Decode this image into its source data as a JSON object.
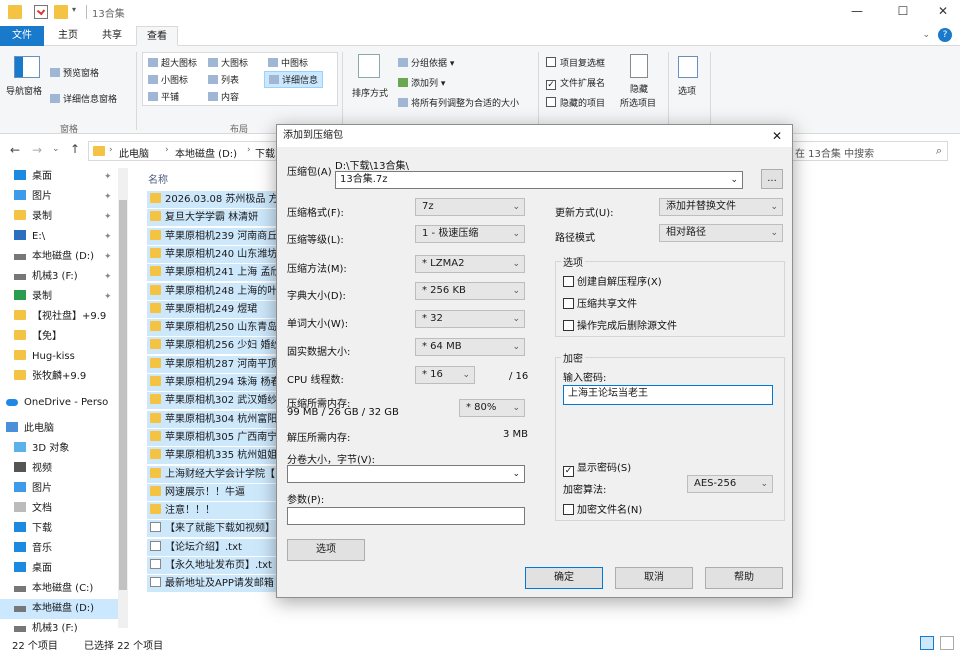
{
  "window": {
    "title": "13合集",
    "controls": {
      "minimize": "—",
      "maximize": "☐",
      "close": "✕"
    }
  },
  "ribbon_tabs": [
    "文件",
    "主页",
    "共享",
    "查看"
  ],
  "ribbon": {
    "pane_group": {
      "nav_pane": "导航窗格",
      "preview_pane": "预览窗格",
      "details_pane": "详细信息窗格",
      "label": "窗格"
    },
    "layout_group": {
      "items": [
        "超大图标",
        "大图标",
        "中图标",
        "小图标",
        "列表",
        "详细信息",
        "平铺",
        "内容"
      ],
      "label": "布局"
    },
    "current_view_group": {
      "sort": "排序方式",
      "group_by": "分组依据",
      "add_column": "添加列",
      "fit_columns": "将所有列调整为合适的大小"
    },
    "show_hide_group": {
      "item_checkbox": "项目复选框",
      "file_ext": "文件扩展名",
      "hidden_items": "隐藏的项目",
      "hide_selected_1": "隐藏",
      "hide_selected_2": "所选项目"
    },
    "options": "选项"
  },
  "address": {
    "path": [
      "此电脑",
      "本地磁盘 (D:)",
      "下载"
    ],
    "search_placeholder": "在 13合集 中搜索"
  },
  "nav": [
    {
      "label": "桌面",
      "pinned": true
    },
    {
      "label": "图片",
      "pinned": true
    },
    {
      "label": "录制",
      "pinned": true
    },
    {
      "label": "E:\\",
      "pinned": true
    },
    {
      "label": "本地磁盘 (D:)",
      "pinned": true
    },
    {
      "label": "机械3 (F:)",
      "pinned": true
    },
    {
      "label": "录制",
      "pinned": true
    },
    {
      "label": "【视社盘】+9.9",
      "pinned": false
    },
    {
      "label": "【免】",
      "pinned": false
    },
    {
      "label": "Hug-kiss",
      "pinned": false
    },
    {
      "label": "张牧麟+9.9",
      "pinned": false
    },
    {
      "label": "OneDrive - Perso",
      "pinned": false
    },
    {
      "label": "此电脑",
      "pinned": false
    },
    {
      "label": "3D 对象",
      "pinned": false
    },
    {
      "label": "视频",
      "pinned": false
    },
    {
      "label": "图片",
      "pinned": false
    },
    {
      "label": "文档",
      "pinned": false
    },
    {
      "label": "下载",
      "pinned": false
    },
    {
      "label": "音乐",
      "pinned": false
    },
    {
      "label": "桌面",
      "pinned": false
    },
    {
      "label": "本地磁盘 (C:)",
      "pinned": false
    },
    {
      "label": "本地磁盘 (D:)",
      "pinned": false
    },
    {
      "label": "机械3 (F:)",
      "pinned": false
    }
  ],
  "filelist": {
    "header": "名称",
    "rows": [
      {
        "name": "2026.03.08 苏州极品 方",
        "type": "folder"
      },
      {
        "name": "复旦大学学霸 林清妍",
        "type": "folder"
      },
      {
        "name": "苹果原相机239 河南商丘",
        "type": "folder"
      },
      {
        "name": "苹果原相机240 山东潍坊",
        "type": "folder"
      },
      {
        "name": "苹果原相机241 上海 孟欣",
        "type": "folder"
      },
      {
        "name": "苹果原相机248 上海的叶",
        "type": "folder"
      },
      {
        "name": "苹果原相机249 煜珺",
        "type": "folder"
      },
      {
        "name": "苹果原相机250 山东青岛",
        "type": "folder"
      },
      {
        "name": "苹果原相机256 少妇 婚纱",
        "type": "folder"
      },
      {
        "name": "苹果原相机287 河南平顶",
        "type": "folder"
      },
      {
        "name": "苹果原相机294 珠海 杨春",
        "type": "folder"
      },
      {
        "name": "苹果原相机302 武汉婚纱",
        "type": "folder"
      },
      {
        "name": "苹果原相机304 杭州富阳",
        "type": "folder"
      },
      {
        "name": "苹果原相机305 广西南宁",
        "type": "folder"
      },
      {
        "name": "苹果原相机335 杭州姐姐",
        "type": "folder"
      },
      {
        "name": "上海财经大学会计学院【",
        "type": "folder"
      },
      {
        "name": "网速展示！！牛逼",
        "type": "folder"
      },
      {
        "name": "注意！！！",
        "type": "folder"
      },
      {
        "name": "【来了就能下载如视频】.",
        "type": "txt"
      },
      {
        "name": "【论坛介绍】.txt",
        "type": "txt"
      },
      {
        "name": "【永久地址发布页】.txt",
        "type": "txt"
      },
      {
        "name": "最新地址及APP请发邮箱",
        "type": "txt"
      }
    ]
  },
  "status": {
    "count": "22 个项目",
    "selected": "已选择 22 个项目"
  },
  "dialog": {
    "title": "添加到压缩包",
    "archive_label": "压缩包(A)",
    "archive_dir": "D:\\下载\\13合集\\",
    "archive_name": "13合集.7z",
    "browse": "...",
    "format_label": "压缩格式(F):",
    "format_value": "7z",
    "level_label": "压缩等级(L):",
    "level_value": "1 - 极速压缩",
    "method_label": "压缩方法(M):",
    "method_value": "* LZMA2",
    "dict_label": "字典大小(D):",
    "dict_value": "* 256 KB",
    "word_label": "单词大小(W):",
    "word_value": "* 32",
    "solid_label": "固实数据大小:",
    "solid_value": "* 64 MB",
    "cpu_label": "CPU 线程数:",
    "cpu_value": "* 16",
    "cpu_total": "/ 16",
    "mem_label": "压缩所需内存:",
    "mem_detail": "99 MB / 26 GB / 32 GB",
    "mem_pct": "* 80%",
    "decomp_label": "解压所需内存:",
    "decomp_value": "3 MB",
    "split_label": "分卷大小，字节(V):",
    "split_value": "",
    "params_label": "参数(P):",
    "params_value": "",
    "options_btn": "选项",
    "update_label": "更新方式(U):",
    "update_value": "添加并替换文件",
    "path_label": "路径模式",
    "path_value": "相对路径",
    "options_group": "选项",
    "opt_sfx": "创建自解压程序(X)",
    "opt_shared": "压缩共享文件",
    "opt_delete": "操作完成后删除源文件",
    "enc_group": "加密",
    "pwd_label": "输入密码:",
    "pwd_value": "上海王论坛当老王",
    "show_pwd": "显示密码(S)",
    "enc_method_label": "加密算法:",
    "enc_method_value": "AES-256",
    "enc_names": "加密文件名(N)",
    "ok": "确定",
    "cancel": "取消",
    "help": "帮助"
  },
  "colors": {
    "accent": "#1979ca",
    "folder": "#f5c343",
    "selection": "#cde7fb"
  }
}
